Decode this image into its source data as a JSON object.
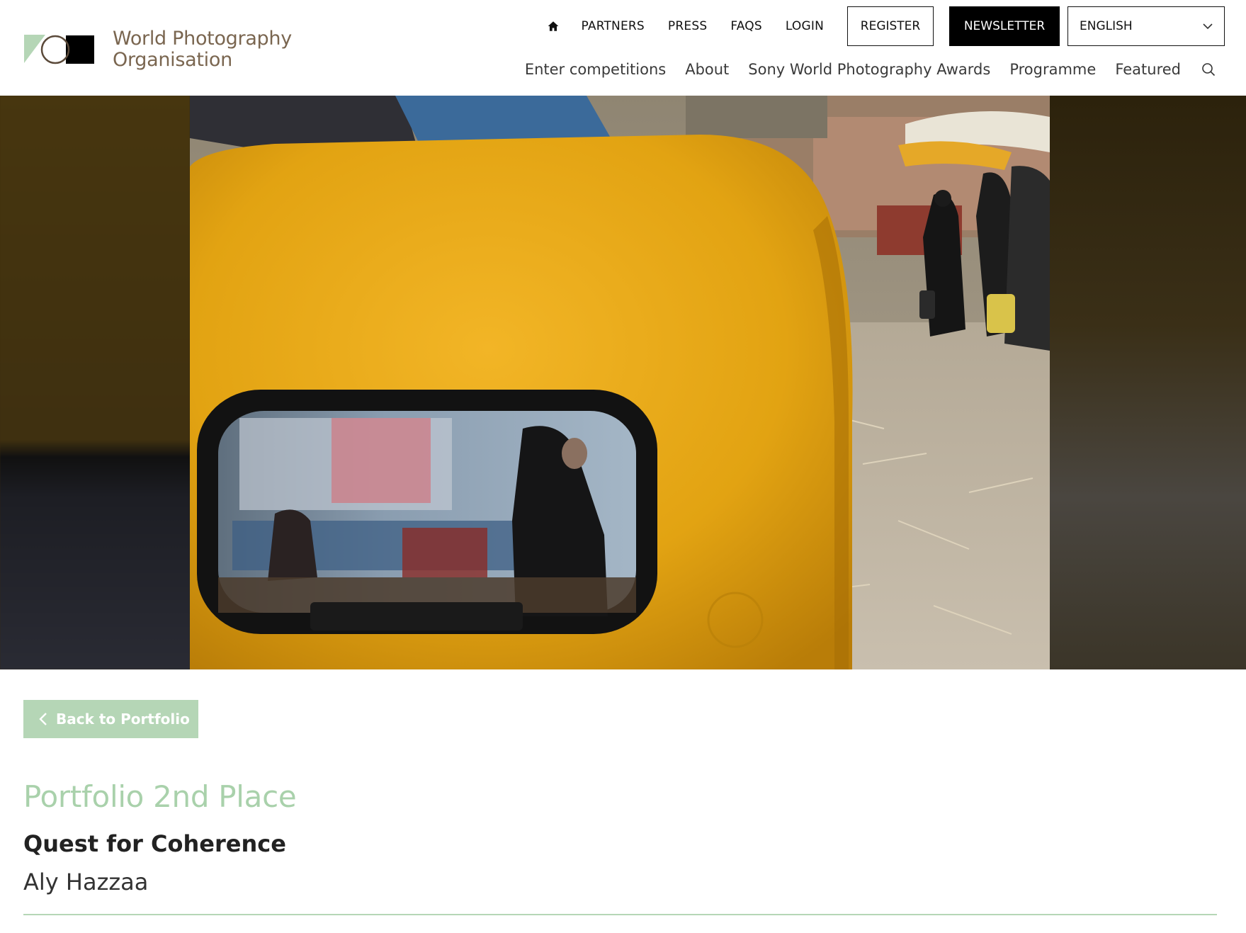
{
  "brand": {
    "name_line1": "World Photography",
    "name_line2": "Organisation",
    "accent": "#b5d6b6",
    "brand_text_color": "#7a6650"
  },
  "utility_nav": {
    "home_icon": "home-icon",
    "links": [
      "PARTNERS",
      "PRESS",
      "FAQS",
      "LOGIN"
    ],
    "register_label": "REGISTER",
    "newsletter_label": "NEWSLETTER",
    "language": "ENGLISH"
  },
  "main_nav": {
    "items": [
      "Enter competitions",
      "About",
      "Sony World Photography Awards",
      "Programme",
      "Featured"
    ],
    "search_icon": "search-icon"
  },
  "content": {
    "back_label": "Back to Portfolio",
    "placing": "Portfolio 2nd Place",
    "title": "Quest for Coherence",
    "artist": "Aly Hazzaa"
  }
}
